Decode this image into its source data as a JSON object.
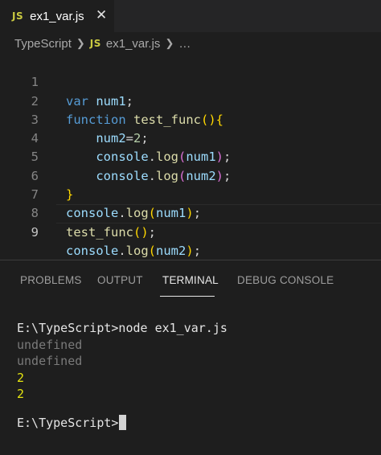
{
  "tab": {
    "badge": "JS",
    "label": "ex1_var.js",
    "close": "✕"
  },
  "breadcrumb": {
    "folder": "TypeScript",
    "badge": "JS",
    "file": "ex1_var.js",
    "ellipsis": "…"
  },
  "editor": {
    "line_numbers": [
      "1",
      "2",
      "3",
      "4",
      "5",
      "6",
      "7",
      "8",
      "9"
    ],
    "current_line": 9
  },
  "panel": {
    "tabs": [
      "PROBLEMS",
      "OUTPUT",
      "TERMINAL",
      "DEBUG CONSOLE"
    ],
    "active_tab": "TERMINAL"
  },
  "terminal": {
    "command_line": "E:\\TypeScript>node ex1_var.js",
    "out1": "undefined",
    "out2": "undefined",
    "out3": "2",
    "out4": "2",
    "prompt": "E:\\TypeScript>"
  },
  "colors": {
    "keyword": "#569cd6",
    "variable": "#9cdcfe",
    "function": "#dcdcaa",
    "number": "#b5cea8",
    "bracket1": "#ffd700",
    "bracket2": "#da70d6",
    "terminal_yellow": "#e5e510"
  }
}
